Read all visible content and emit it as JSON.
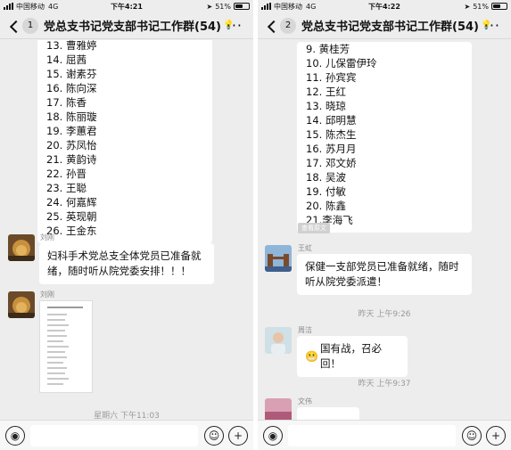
{
  "left": {
    "status": {
      "carrier": "中国移动",
      "network": "4G",
      "time": "下午4:21",
      "battery": "51%",
      "battery_level": 0.51
    },
    "nav": {
      "unread": "1",
      "title": "党总支书记党支部书记工作群(54)"
    },
    "list": [
      "13. 曹雅婷",
      "14. 屈茜",
      "15. 谢素芬",
      "16. 陈向深",
      "17. 陈香",
      "18. 陈丽璇",
      "19. 李蕙君",
      "20. 苏凤怡",
      "21. 黄韵诗",
      "22. 孙晋",
      "23. 王聪",
      "24. 何嘉辉",
      "25. 英现朝",
      "26. 王金东"
    ],
    "messages": [
      {
        "sender": "刘刚",
        "text": "妇科手术党总支全体党员已准备就绪，随时听从院党委安排！！！"
      },
      {
        "sender": "刘刚"
      }
    ],
    "timestamp_partial": "星期六 下午11:03"
  },
  "right": {
    "status": {
      "carrier": "中国移动",
      "network": "4G",
      "time": "下午4:22",
      "battery": "51%",
      "battery_level": 0.51
    },
    "nav": {
      "unread": "2",
      "title": "党总支书记党支部书记工作群(54)"
    },
    "list": [
      "9. 黄桂芳",
      "10. 儿保雷伊玲",
      "11. 孙宾宾",
      "12. 王红",
      "13. 晓琼",
      "14. 邱明慧",
      "15. 陈杰生",
      "16. 苏月月",
      "17. 邓文娇",
      "18. 吴波",
      "19. 付敏",
      "20. 陈鑫",
      "21.李海飞"
    ],
    "chip": "查看原文",
    "messages": [
      {
        "sender": "王虹",
        "text": "保健一支部党员已准备就绪，随时听从院党委派遣！"
      },
      {
        "timestamp": "昨天 上午9:26"
      },
      {
        "sender": "周洁",
        "text": "国有战，召必回！"
      },
      {
        "timestamp": "昨天 上午9:37"
      },
      {
        "sender": "文伟"
      }
    ]
  },
  "icons": {
    "voice": "voice-icon",
    "emoji": "emoji-icon",
    "plus": "plus-icon",
    "back": "back-chevron-icon",
    "more": "more-icon"
  }
}
